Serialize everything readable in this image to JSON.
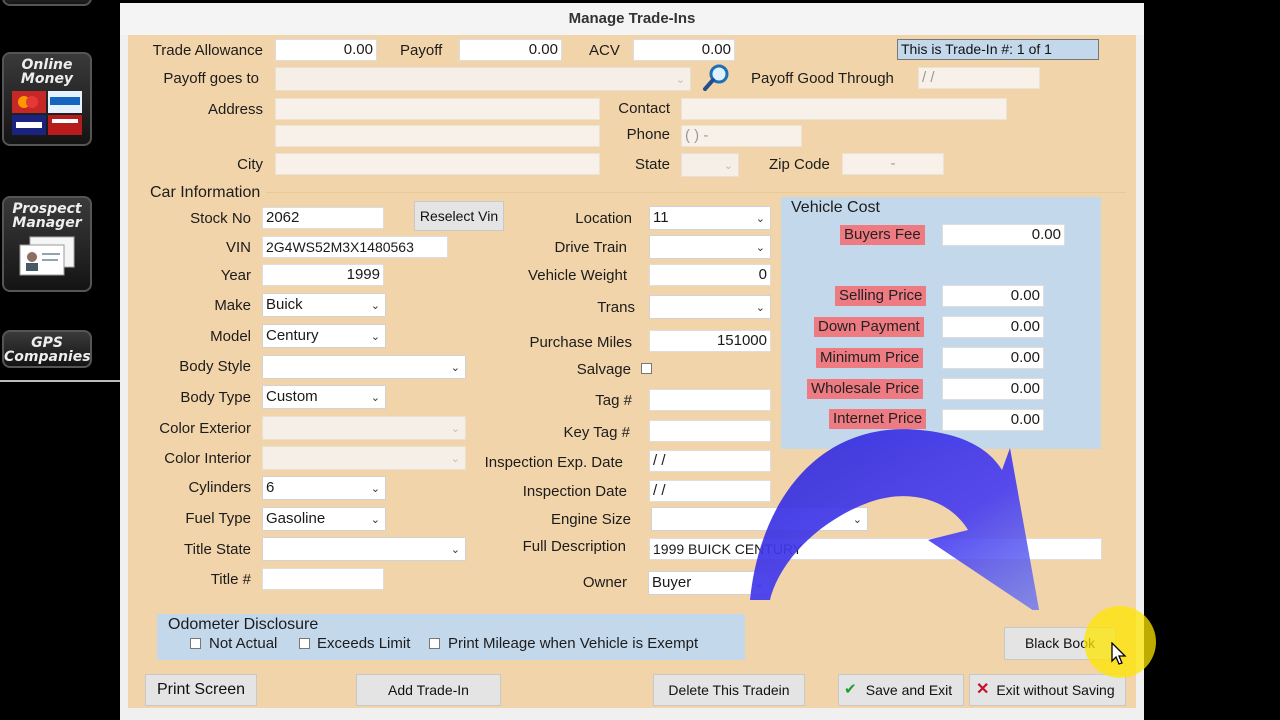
{
  "sidebar": {
    "online_money": "Online Money",
    "prospect_manager": "Prospect Manager",
    "gps_companies": "GPS Companies"
  },
  "window": {
    "title": "Manage Trade-Ins"
  },
  "top": {
    "trade_allowance_label": "Trade Allowance",
    "trade_allowance": "0.00",
    "payoff_label": "Payoff",
    "payoff": "0.00",
    "acv_label": "ACV",
    "acv": "0.00",
    "tradein_number": "This is Trade-In #: 1 of 1",
    "payoff_goes_to_label": "Payoff goes to",
    "payoff_goes_to": "",
    "payoff_good_through_label": "Payoff Good Through",
    "payoff_good_through": "/  /",
    "address_label": "Address",
    "address1": "",
    "address2": "",
    "contact_label": "Contact",
    "contact": "",
    "phone_label": "Phone",
    "phone": "(   )    -",
    "city_label": "City",
    "city": "",
    "state_label": "State",
    "state": "",
    "zip_label": "Zip Code",
    "zip": "-"
  },
  "car": {
    "section_label": "Car Information",
    "stock_no_label": "Stock No",
    "stock_no": "2062",
    "reselect_vin": "Reselect Vin",
    "vin_label": "VIN",
    "vin": "2G4WS52M3X1480563",
    "year_label": "Year",
    "year": "1999",
    "make_label": "Make",
    "make": "Buick",
    "model_label": "Model",
    "model": "Century",
    "body_style_label": "Body Style",
    "body_style": "",
    "body_type_label": "Body Type",
    "body_type": "Custom",
    "color_ext_label": "Color Exterior",
    "color_ext": "",
    "color_int_label": "Color Interior",
    "color_int": "",
    "cylinders_label": "Cylinders",
    "cylinders": "6",
    "fuel_type_label": "Fuel Type",
    "fuel_type": "Gasoline",
    "title_state_label": "Title State",
    "title_state": "",
    "title_no_label": "Title #",
    "title_no": "",
    "location_label": "Location",
    "location": "11",
    "drive_train_label": "Drive Train",
    "drive_train": "",
    "vehicle_weight_label": "Vehicle Weight",
    "vehicle_weight": "0",
    "trans_label": "Trans",
    "trans": "",
    "purchase_miles_label": "Purchase Miles",
    "purchase_miles": "151000",
    "salvage_label": "Salvage",
    "tag_label": "Tag #",
    "tag": "",
    "key_tag_label": "Key Tag #",
    "key_tag": "",
    "inspection_exp_label": "Inspection Exp. Date",
    "inspection_exp": "/  /",
    "inspection_date_label": "Inspection Date",
    "inspection_date": "/  /",
    "engine_size_label": "Engine Size",
    "engine_size": "",
    "full_desc_label": "Full Description",
    "full_desc": "1999 BUICK CENTURY",
    "owner_label": "Owner",
    "owner": "Buyer"
  },
  "vehicle_cost": {
    "title": "Vehicle Cost",
    "buyers_fee_label": "Buyers Fee",
    "buyers_fee": "0.00",
    "selling_price_label": "Selling Price",
    "selling_price": "0.00",
    "down_payment_label": "Down Payment",
    "down_payment": "0.00",
    "minimum_price_label": "Minimum Price",
    "minimum_price": "0.00",
    "wholesale_price_label": "Wholesale Price",
    "wholesale_price": "0.00",
    "internet_price_label": "Internet Price",
    "internet_price": "0.00"
  },
  "odometer": {
    "title": "Odometer Disclosure",
    "not_actual": "Not Actual",
    "exceeds_limit": "Exceeds Limit",
    "print_mileage": "Print Mileage when Vehicle is Exempt"
  },
  "buttons": {
    "black_book": "Black Book",
    "print_screen": "Print Screen",
    "add_tradein": "Add Trade-In",
    "delete_tradein": "Delete This Tradein",
    "save_exit": "Save and Exit",
    "exit_no_save": "Exit without Saving"
  },
  "icons": {
    "magnifier": "magnifier-icon",
    "check": "check-icon",
    "close": "close-x-icon",
    "cursor": "mouse-pointer-icon"
  },
  "colors": {
    "panel": "#f2d4aa",
    "blue_panel": "#c4d8ec",
    "red_label": "#ef7b82",
    "annotation_arrow": "#3a32e0",
    "cursor_highlight": "#ffe600"
  }
}
